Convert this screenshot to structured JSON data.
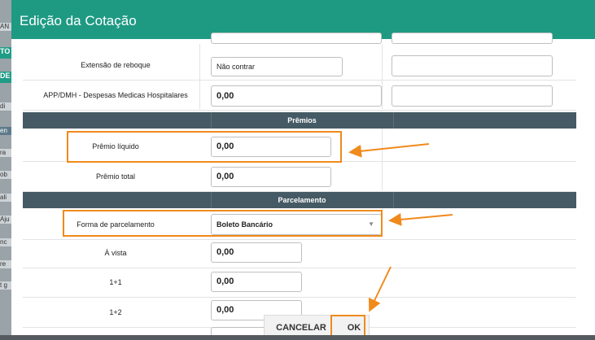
{
  "modal": {
    "title": "Edição da Cotação"
  },
  "background_fragments": [
    "AN",
    "TO",
    "DE",
    "di",
    "en",
    "ra",
    "ob",
    "ali",
    "Aju",
    "nc",
    "re",
    "t g"
  ],
  "rows": {
    "extensao": {
      "label": "Extensão de reboque",
      "value": "Não contrar"
    },
    "app": {
      "label": "APP/DMH - Despesas Medicas Hospitalares",
      "value": "0,00"
    },
    "premio_liquido": {
      "label": "Prêmio líquido",
      "value": "0,00"
    },
    "premio_total": {
      "label": "Prêmio total",
      "value": "0,00"
    },
    "forma": {
      "label": "Forma de parcelamento",
      "value": "Boleto Bancário"
    },
    "avista": {
      "label": "À vista",
      "value": "0,00"
    },
    "p1": {
      "label": "1+1",
      "value": "0,00"
    },
    "p2": {
      "label": "1+2",
      "value": "0,00"
    }
  },
  "sections": {
    "premios": "Prêmios",
    "parcelamento": "Parcelamento"
  },
  "footer": {
    "cancel": "CANCELAR",
    "ok": "OK"
  },
  "colors": {
    "header": "#1e9a83",
    "section": "#455a64",
    "annotation": "#f08a1c"
  }
}
